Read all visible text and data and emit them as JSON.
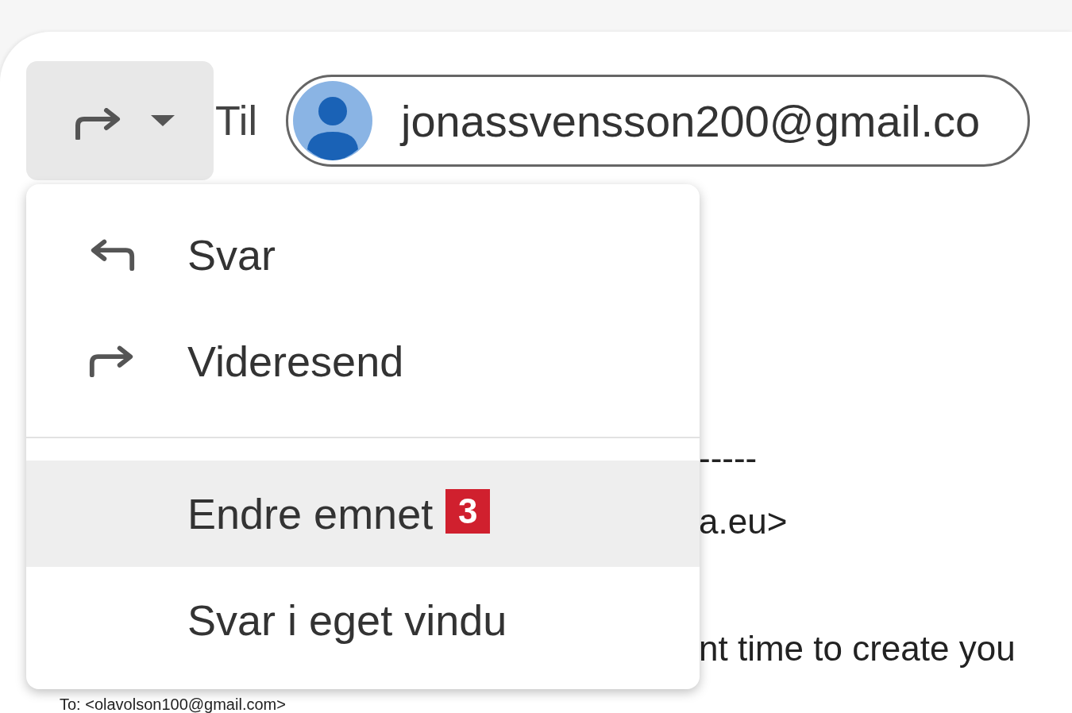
{
  "recipients": {
    "label": "Til",
    "chips": [
      {
        "email": "jonassvensson200@gmail.co"
      }
    ]
  },
  "menu": {
    "groups": [
      {
        "items": [
          {
            "kind": "reply",
            "label": "Svar",
            "selected": false
          },
          {
            "kind": "forward",
            "label": "Videresend",
            "selected": false
          }
        ]
      },
      {
        "items": [
          {
            "kind": "plain",
            "label": "Endre emnet",
            "selected": true,
            "badge": "3"
          },
          {
            "kind": "plain",
            "label": "Svar i eget vindu",
            "selected": false
          }
        ]
      }
    ]
  },
  "body": {
    "header_lines": [
      "-----",
      "a.eu>"
    ],
    "paragraph": "nt time to create you"
  },
  "to_line": "To: <olavolson100@gmail.com>"
}
